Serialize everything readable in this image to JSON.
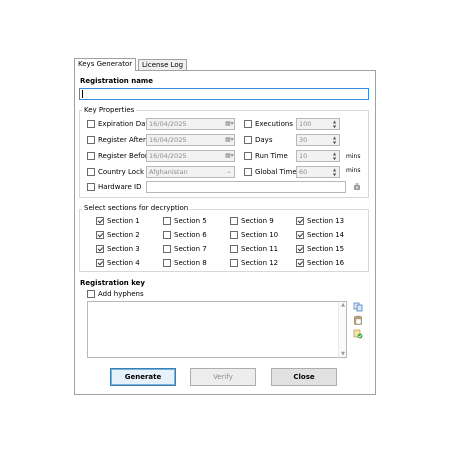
{
  "tabs": [
    {
      "label": "Keys Generator",
      "active": true
    },
    {
      "label": "License Log",
      "active": false
    }
  ],
  "registration_name": {
    "label": "Registration name",
    "value": ""
  },
  "key_properties": {
    "label": "Key Properties",
    "rows": [
      {
        "label": "Expiration Date",
        "checked": false,
        "value": "16/04/2025"
      },
      {
        "label": "Register After",
        "checked": false,
        "value": "16/04/2025"
      },
      {
        "label": "Register Before",
        "checked": false,
        "value": "16/04/2025"
      },
      {
        "label": "Country Lock",
        "checked": false,
        "value": "Afghanistan"
      },
      {
        "label": "Hardware ID",
        "checked": false,
        "value": ""
      }
    ],
    "right_rows": [
      {
        "label": "Executions",
        "checked": false,
        "value": "100",
        "unit": ""
      },
      {
        "label": "Days",
        "checked": false,
        "value": "30",
        "unit": ""
      },
      {
        "label": "Run Time",
        "checked": false,
        "value": "10",
        "unit": "mins"
      },
      {
        "label": "Global Time",
        "checked": false,
        "value": "60",
        "unit": "mins"
      }
    ]
  },
  "sections": {
    "label": "Select sections for decryption",
    "items": [
      {
        "label": "Section 1",
        "checked": true
      },
      {
        "label": "Section 2",
        "checked": true
      },
      {
        "label": "Section 3",
        "checked": true
      },
      {
        "label": "Section 4",
        "checked": true
      },
      {
        "label": "Section 5",
        "checked": false
      },
      {
        "label": "Section 6",
        "checked": false
      },
      {
        "label": "Section 7",
        "checked": false
      },
      {
        "label": "Section 8",
        "checked": false
      },
      {
        "label": "Section 9",
        "checked": false
      },
      {
        "label": "Section 10",
        "checked": false
      },
      {
        "label": "Section 11",
        "checked": false
      },
      {
        "label": "Section 12",
        "checked": false
      },
      {
        "label": "Section 13",
        "checked": true
      },
      {
        "label": "Section 14",
        "checked": true
      },
      {
        "label": "Section 15",
        "checked": true
      },
      {
        "label": "Section 16",
        "checked": true
      }
    ]
  },
  "registration_key": {
    "label": "Registration key",
    "add_hyphens_label": "Add hyphens",
    "add_hyphens_checked": false,
    "value": ""
  },
  "buttons": {
    "generate": "Generate",
    "verify": "Verify",
    "close": "Close"
  },
  "icons": {
    "hardware": "hardware-chip-icon",
    "copy": "copy-icon",
    "paste": "paste-icon",
    "save": "save-icon"
  },
  "colors": {
    "focus_border": "#3b8ad8",
    "default_button_border": "#3c7fb1",
    "window_bg": "#ffffff"
  }
}
